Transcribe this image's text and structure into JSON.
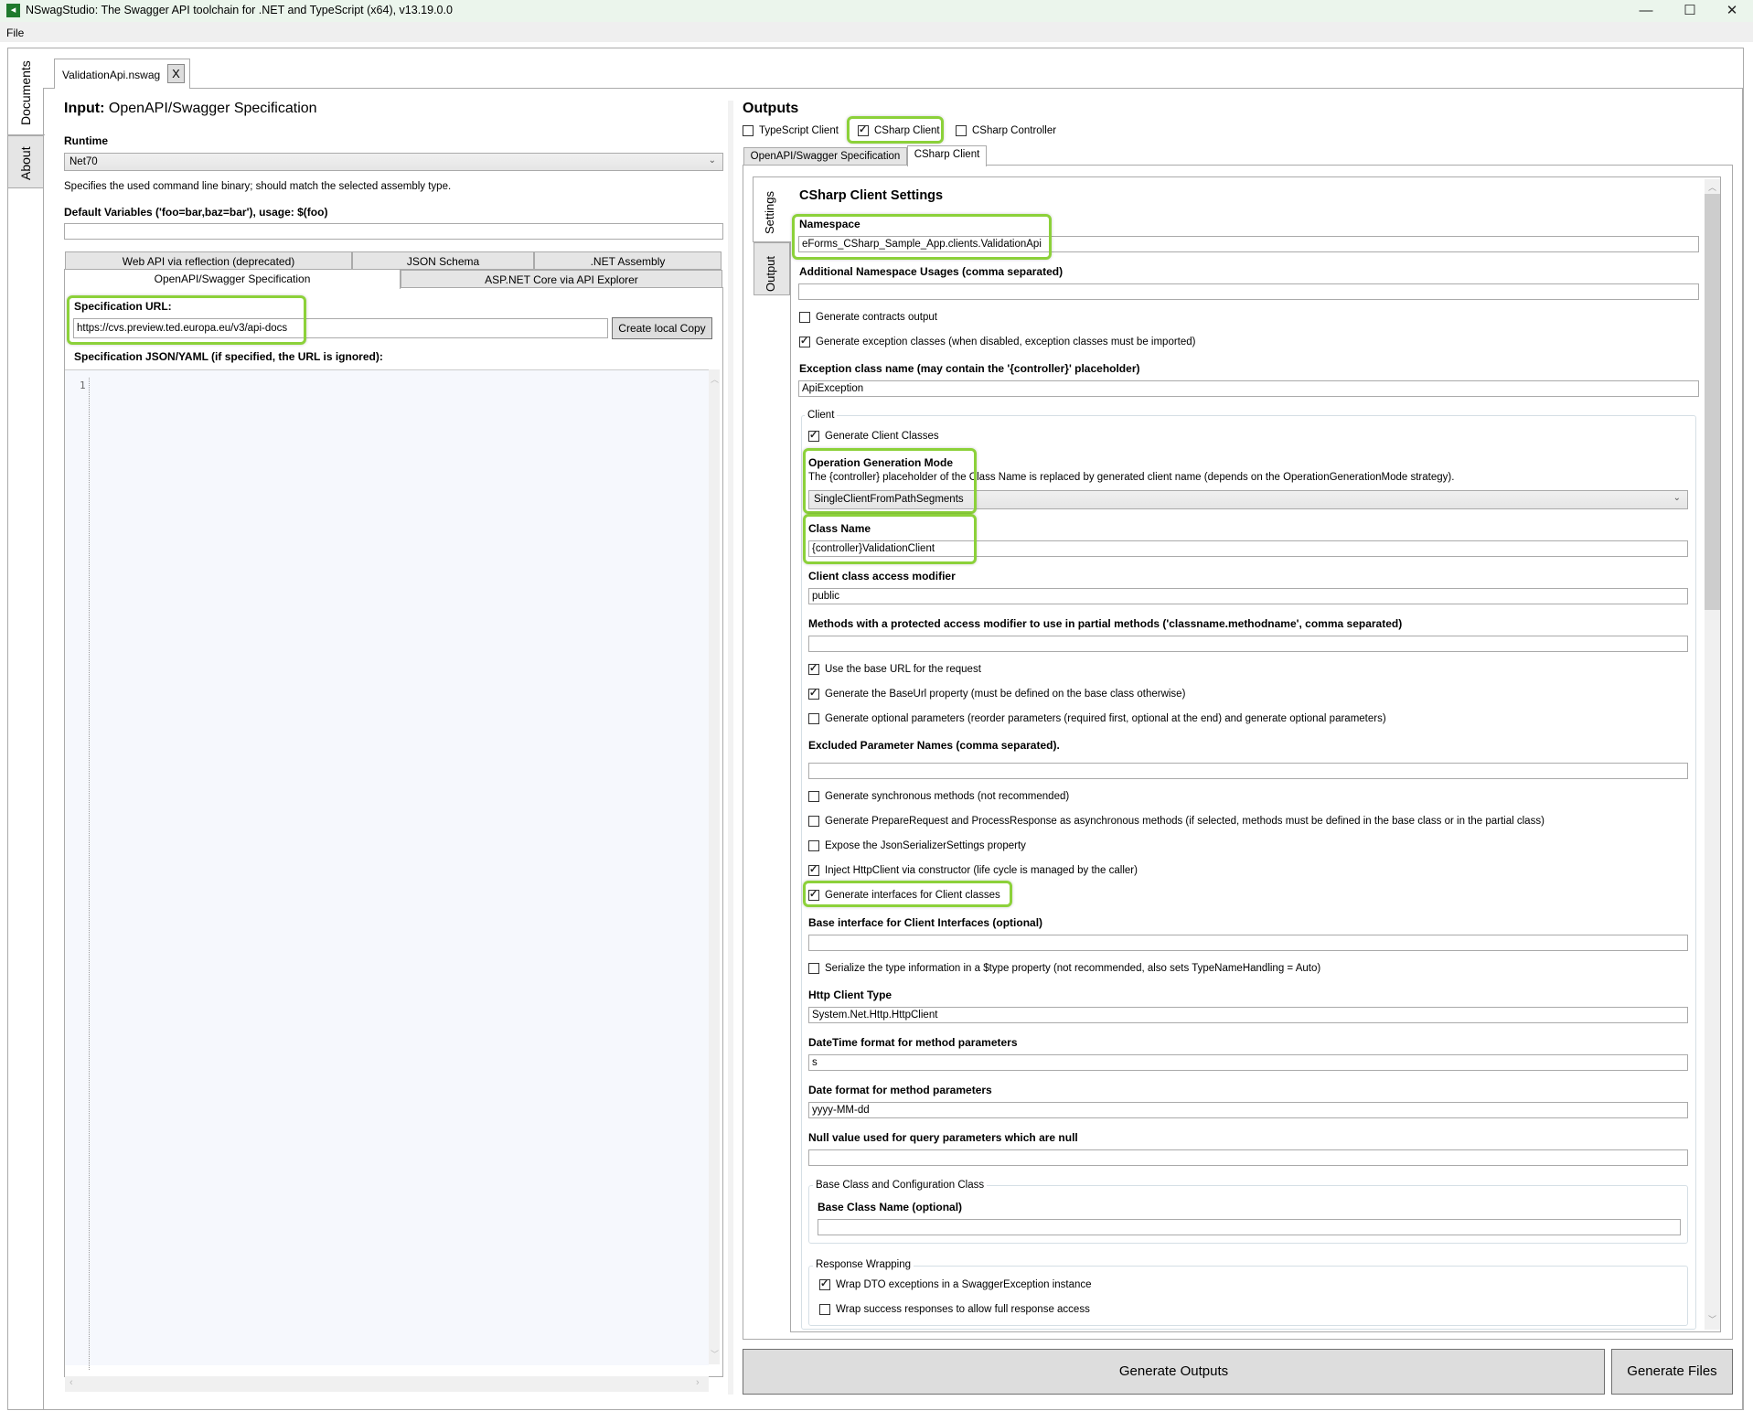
{
  "window": {
    "title": "NSwagStudio: The Swagger API toolchain for .NET and TypeScript (x64), v13.19.0.0",
    "controls": [
      "minimize-icon",
      "maximize-icon",
      "close-icon"
    ],
    "minimize_glyph": "—",
    "maximize_glyph": "☐",
    "close_glyph": "✕"
  },
  "menu": {
    "file": "File"
  },
  "side_tabs": [
    {
      "label": "Documents",
      "active": true
    },
    {
      "label": "About",
      "active": false
    }
  ],
  "document_tab": {
    "label": "ValidationApi.nswag",
    "close": "X"
  },
  "input": {
    "heading_bold": "Input:",
    "heading_rest": " OpenAPI/Swagger Specification",
    "runtime_label": "Runtime",
    "runtime_value": "Net70",
    "runtime_help": "Specifies the used command line binary; should match the selected assembly type.",
    "default_vars_label": "Default Variables ('foo=bar,baz=bar'), usage: $(foo)",
    "default_vars_value": "",
    "tabs_row1": [
      "Web API via reflection (deprecated)",
      "JSON Schema",
      ".NET Assembly"
    ],
    "tabs_row2": [
      "OpenAPI/Swagger Specification",
      "ASP.NET Core via API Explorer"
    ],
    "active_tab": "OpenAPI/Swagger Specification",
    "spec_url_label": "Specification URL:",
    "spec_url_value": "https://cvs.preview.ted.europa.eu/v3/api-docs",
    "create_local_copy": "Create local Copy",
    "spec_json_label": "Specification JSON/YAML (if specified, the URL is ignored):",
    "editor_line_number": "1"
  },
  "outputs": {
    "heading": "Outputs",
    "checkboxes": [
      {
        "label": "TypeScript Client",
        "checked": false
      },
      {
        "label": "CSharp Client",
        "checked": true
      },
      {
        "label": "CSharp Controller",
        "checked": false
      }
    ],
    "tabs": [
      "OpenAPI/Swagger Specification",
      "CSharp Client"
    ],
    "active_tab": "CSharp Client",
    "vertical_tabs": [
      "Settings",
      "Output"
    ],
    "settings_title": "CSharp Client Settings",
    "namespace_label": "Namespace",
    "namespace_value": "eForms_CSharp_Sample_App.clients.ValidationApi",
    "additional_ns_label": "Additional Namespace Usages (comma separated)",
    "additional_ns_value": "",
    "generate_contracts": {
      "label": "Generate contracts output",
      "checked": false
    },
    "generate_exceptions": {
      "label": "Generate exception classes (when disabled, exception classes must be imported)",
      "checked": true
    },
    "exception_class_label": "Exception class name (may contain the '{controller}' placeholder)",
    "exception_class_value": "ApiException",
    "client_group": {
      "legend": "Client",
      "generate_client_classes": {
        "label": "Generate Client Classes",
        "checked": true
      },
      "op_mode_label": "Operation Generation Mode",
      "op_mode_help": "The {controller} placeholder of the Class Name is replaced by generated client name (depends on the OperationGenerationMode strategy).",
      "op_mode_value": "SingleClientFromPathSegments",
      "class_name_label": "Class Name",
      "class_name_value": "{controller}ValidationClient",
      "access_modifier_label": "Client class access modifier",
      "access_modifier_value": "public",
      "protected_methods_label": "Methods with a protected access modifier to use in partial methods ('classname.methodname', comma separated)",
      "protected_methods_value": "",
      "use_base_url": {
        "label": "Use the base URL for the request",
        "checked": true
      },
      "generate_base_url": {
        "label": "Generate the BaseUrl property (must be defined on the base class otherwise)",
        "checked": true
      },
      "generate_optional": {
        "label": "Generate optional parameters (reorder parameters (required first, optional at the end) and generate optional parameters)",
        "checked": false
      },
      "excluded_params_label": "Excluded Parameter Names (comma separated).",
      "excluded_params_value": "",
      "sync_methods": {
        "label": "Generate synchronous methods (not recommended)",
        "checked": false
      },
      "prepare_async": {
        "label": "Generate PrepareRequest and ProcessResponse as asynchronous methods (if selected, methods must be defined in the base class or in the partial class)",
        "checked": false
      },
      "expose_json": {
        "label": "Expose the JsonSerializerSettings property",
        "checked": false
      },
      "inject_http": {
        "label": "Inject HttpClient via constructor (life cycle is managed by the caller)",
        "checked": true
      },
      "gen_interfaces": {
        "label": "Generate interfaces for Client classes",
        "checked": true
      },
      "base_interface_label": "Base interface for Client Interfaces (optional)",
      "base_interface_value": "",
      "serialize_type": {
        "label": "Serialize the type information in a $type property (not recommended, also sets TypeNameHandling = Auto)",
        "checked": false
      },
      "http_client_type_label": "Http Client Type",
      "http_client_type_value": "System.Net.Http.HttpClient",
      "datetime_format_label": "DateTime format for method parameters",
      "datetime_format_value": "s",
      "date_format_label": "Date format for method parameters",
      "date_format_value": "yyyy-MM-dd",
      "null_value_label": "Null value used for query parameters which are null",
      "null_value_value": "",
      "base_class_group": {
        "legend": "Base Class and Configuration Class",
        "base_class_label": "Base Class Name (optional)",
        "base_class_value": ""
      },
      "response_wrapping": {
        "legend": "Response Wrapping",
        "wrap_dto": {
          "label": "Wrap DTO exceptions in a SwaggerException instance",
          "checked": true
        },
        "wrap_success": {
          "label": "Wrap success responses to allow full response access",
          "checked": false
        }
      }
    },
    "generate_outputs": "Generate Outputs",
    "generate_files": "Generate Files"
  },
  "colors": {
    "highlight": "#8cd13a",
    "titlebar": "#ebf5ec",
    "editor_bg": "#f6f8fd"
  }
}
